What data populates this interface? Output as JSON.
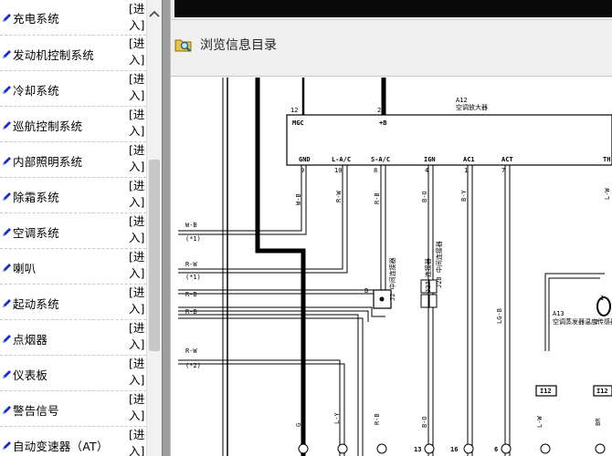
{
  "sidebar": {
    "enter_label": "[进入]",
    "items": [
      {
        "label": "充电系统"
      },
      {
        "label": "发动机控制系统"
      },
      {
        "label": "冷却系统"
      },
      {
        "label": "巡航控制系统"
      },
      {
        "label": "内部照明系统"
      },
      {
        "label": "除霜系统"
      },
      {
        "label": "空调系统"
      },
      {
        "label": "喇叭"
      },
      {
        "label": "起动系统"
      },
      {
        "label": "点烟器"
      },
      {
        "label": "仪表板"
      },
      {
        "label": "警告信号"
      },
      {
        "label": "自动变速器（AT）"
      }
    ]
  },
  "toolbar": {
    "browse_label": "浏览信息目录",
    "icon": "folder-search-icon"
  },
  "diagram": {
    "component_a12_code": "A12",
    "component_a12_name": "空调放大器",
    "component_a13_code": "A13",
    "component_a13_name": "空调蒸发器温度传感器",
    "j2_label": "J2 中间连接器",
    "j27_label": "J27 连接器",
    "j29_label": "J28 中间连接器",
    "pins_top": [
      "MGC",
      "+B"
    ],
    "pin_nums_top": [
      "12",
      "2"
    ],
    "pins_bottom": [
      "GND",
      "L-A/C",
      "S-A/C",
      "IGN",
      "AC1",
      "ACT",
      "TH"
    ],
    "pin_nums_bottom": [
      "9",
      "10",
      "8",
      "4",
      "1",
      "7"
    ],
    "left_wires": [
      "W-B",
      "(*1)",
      "R-W",
      "(*1)",
      "R-B",
      "R-B",
      "R-W",
      "(*2)"
    ],
    "vertical_wire_labels": [
      "W-B",
      "(*1)",
      "R-W",
      "(*1)",
      "R-B",
      "(*1)",
      "B-O",
      "(*1)",
      "B-Y",
      "(*1)",
      "LG-B",
      "L-W",
      "(*1)"
    ],
    "lower_labels": [
      "G",
      "(*2)",
      "L-Y",
      "(*2)",
      "R-B",
      "(*2)",
      "B-O",
      "(*2)",
      "L-W",
      "(*2)",
      "BR",
      "(*2)",
      "BR",
      "(*2)",
      "L-W",
      "(*2)"
    ],
    "bottom_connectors": [
      "13",
      "16",
      "6",
      "I12",
      "I12"
    ],
    "connector_letters": [
      "B",
      "D",
      "B",
      "A",
      "A",
      "A",
      "A",
      "A",
      "A",
      "A"
    ],
    "a13_pins": [
      "1",
      "2"
    ]
  },
  "colors": {
    "sidebar_bg": "#ffffff",
    "splitter": "#9e9e9e",
    "toolbar_bg": "#f0f0f0",
    "icon_blue": "#1530c8"
  }
}
